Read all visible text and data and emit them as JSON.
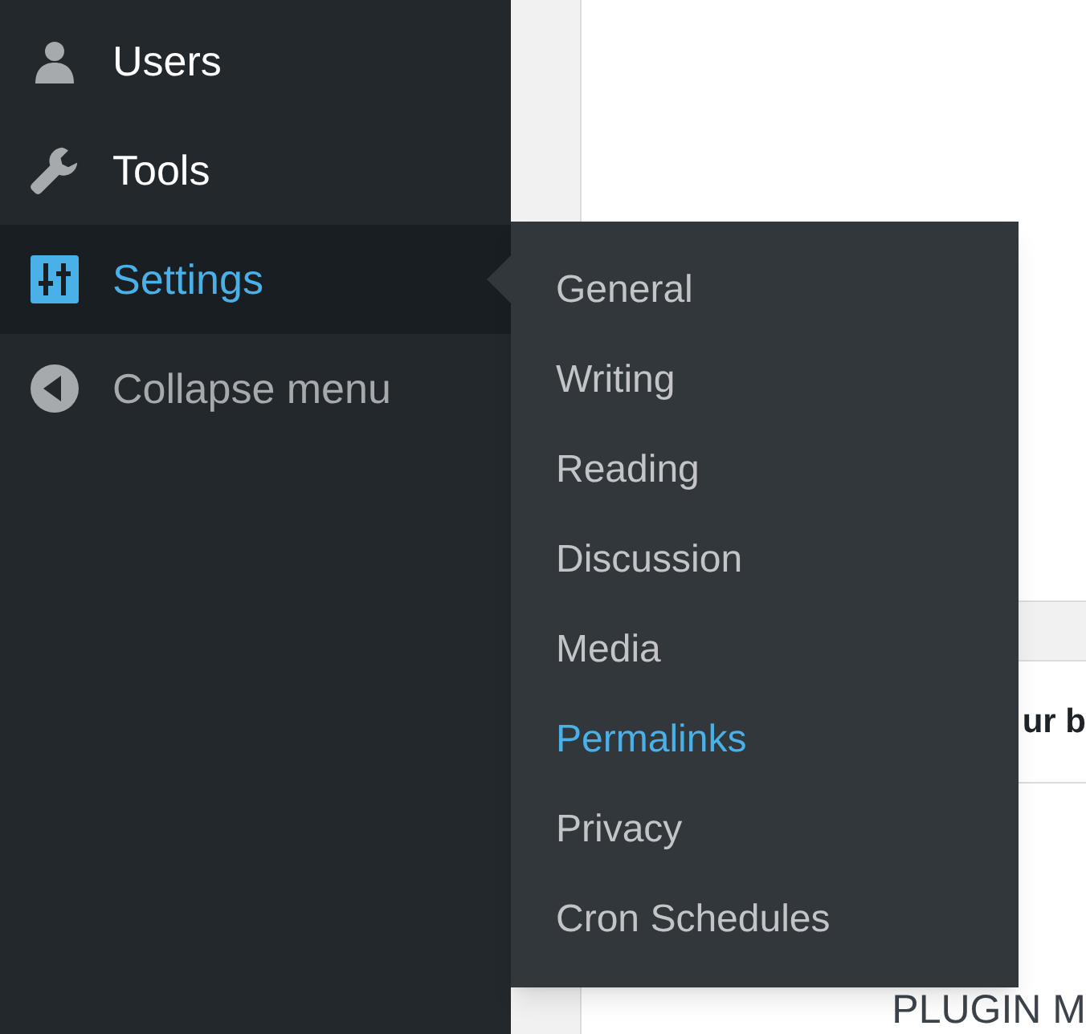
{
  "sidebar": {
    "items": [
      {
        "label": "Users",
        "selected": false,
        "kind": "menu"
      },
      {
        "label": "Tools",
        "selected": false,
        "kind": "menu"
      },
      {
        "label": "Settings",
        "selected": true,
        "kind": "menu"
      },
      {
        "label": "Collapse menu",
        "selected": false,
        "kind": "collapse"
      }
    ]
  },
  "submenu": {
    "items": [
      {
        "label": "General",
        "selected": false
      },
      {
        "label": "Writing",
        "selected": false
      },
      {
        "label": "Reading",
        "selected": false
      },
      {
        "label": "Discussion",
        "selected": false
      },
      {
        "label": "Media",
        "selected": false
      },
      {
        "label": "Permalinks",
        "selected": true
      },
      {
        "label": "Privacy",
        "selected": false
      },
      {
        "label": "Cron Schedules",
        "selected": false
      }
    ]
  },
  "content": {
    "row_text": "ur b",
    "heading": "PLUGIN M"
  }
}
